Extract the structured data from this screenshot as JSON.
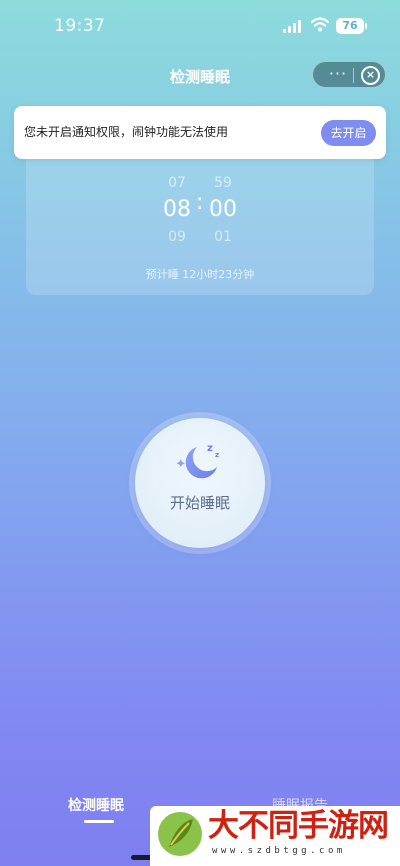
{
  "status_bar": {
    "time": "19:37",
    "battery": "76"
  },
  "nav": {
    "title": "检测睡眠",
    "more": "···",
    "close": "×"
  },
  "picker": {
    "hour_prev": "07",
    "hour": "08",
    "hour_next": "09",
    "minute_prev": "59",
    "minute": "00",
    "minute_next": "01",
    "colon": ":",
    "estimate": "预计睡 12小时23分钟"
  },
  "banner": {
    "text": "您未开启通知权限，闹钟功能无法使用",
    "button": "去开启"
  },
  "start": {
    "label": "开始睡眠"
  },
  "tabs": [
    {
      "label": "检测睡眠",
      "active": true
    },
    {
      "label": "睡眠报告",
      "active": false
    }
  ],
  "watermark": {
    "text": "大不同手游网",
    "url": "www.szdbtgg.com"
  }
}
